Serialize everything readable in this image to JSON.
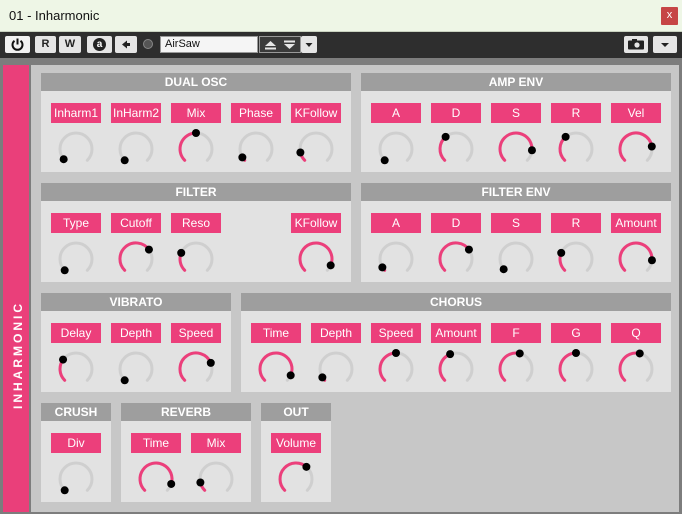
{
  "window": {
    "title": "01 - Inharmonic",
    "close_label": "x"
  },
  "toolbar": {
    "power_icon": "power-icon",
    "read_label": "R",
    "write_label": "W",
    "auto_label": "a",
    "preset_name": "AirSaw"
  },
  "instrument": {
    "side_label": "INHARMONIC"
  },
  "colors": {
    "accent": "#ec3f7b",
    "section_header": "#9e9e9e",
    "panel": "#e2e2e2",
    "track": "#cfcfcf"
  },
  "sections": [
    {
      "id": "dual-osc",
      "title": "DUAL OSC",
      "params": [
        {
          "label": "Inharm1",
          "value": 0.02
        },
        {
          "label": "InHarm2",
          "value": 0.0
        },
        {
          "label": "Mix",
          "value": 0.5
        },
        {
          "label": "Phase",
          "value": 0.05
        },
        {
          "label": "KFollow",
          "value": 0.12
        }
      ]
    },
    {
      "id": "amp-env",
      "title": "AMP ENV",
      "params": [
        {
          "label": "A",
          "value": 0.0
        },
        {
          "label": "D",
          "value": 0.35
        },
        {
          "label": "S",
          "value": 0.85
        },
        {
          "label": "R",
          "value": 0.35
        },
        {
          "label": "Vel",
          "value": 0.8
        }
      ]
    },
    {
      "id": "filter",
      "title": "FILTER",
      "params": [
        {
          "label": "Type",
          "value": 0.0
        },
        {
          "label": "Cutoff",
          "value": 0.7
        },
        {
          "label": "Reso",
          "value": 0.25
        },
        {
          "label": "KFollow",
          "value": 0.92
        }
      ]
    },
    {
      "id": "filter-env",
      "title": "FILTER ENV",
      "params": [
        {
          "label": "A",
          "value": 0.05
        },
        {
          "label": "D",
          "value": 0.7
        },
        {
          "label": "S",
          "value": 0.02
        },
        {
          "label": "R",
          "value": 0.25
        },
        {
          "label": "Amount",
          "value": 0.85
        }
      ]
    },
    {
      "id": "vibrato",
      "title": "VIBRATO",
      "params": [
        {
          "label": "Delay",
          "value": 0.3
        },
        {
          "label": "Depth",
          "value": 0.0
        },
        {
          "label": "Speed",
          "value": 0.75
        }
      ]
    },
    {
      "id": "chorus",
      "title": "CHORUS",
      "params": [
        {
          "label": "Time",
          "value": 0.92
        },
        {
          "label": "Depth",
          "value": 0.05
        },
        {
          "label": "Speed",
          "value": 0.5
        },
        {
          "label": "Amount",
          "value": 0.42
        },
        {
          "label": "F",
          "value": 0.55
        },
        {
          "label": "G",
          "value": 0.5
        },
        {
          "label": "Q",
          "value": 0.55
        }
      ]
    },
    {
      "id": "crush",
      "title": "CRUSH",
      "params": [
        {
          "label": "Div",
          "value": 0.0
        }
      ]
    },
    {
      "id": "reverb",
      "title": "REVERB",
      "params": [
        {
          "label": "Time",
          "value": 0.9
        },
        {
          "label": "Mix",
          "value": 0.12
        }
      ]
    },
    {
      "id": "out",
      "title": "OUT",
      "params": [
        {
          "label": "Volume",
          "value": 0.65
        }
      ]
    }
  ]
}
